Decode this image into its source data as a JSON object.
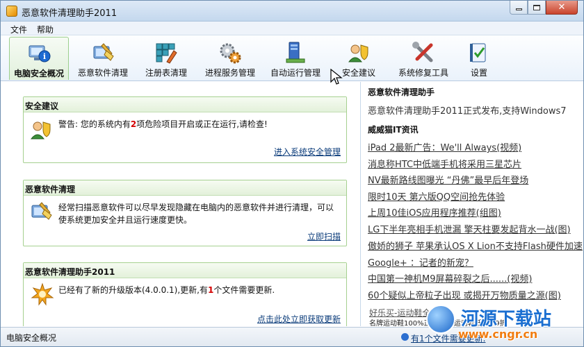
{
  "window": {
    "title": "恶意软件清理助手2011"
  },
  "menu": [
    "文件",
    "帮助"
  ],
  "toolbar": {
    "items": [
      {
        "label": "电脑安全概况",
        "icon": "pc-info-icon",
        "active": true
      },
      {
        "label": "恶意软件清理",
        "icon": "malware-clean-icon",
        "active": false
      },
      {
        "label": "注册表清理",
        "icon": "registry-clean-icon",
        "active": false
      },
      {
        "label": "进程服务管理",
        "icon": "gears-icon",
        "active": false
      },
      {
        "label": "自动运行管理",
        "icon": "autorun-icon",
        "active": false
      },
      {
        "label": "安全建议",
        "icon": "security-user-icon",
        "active": false
      },
      {
        "label": "系统修复工具",
        "icon": "repair-tools-icon",
        "active": false
      },
      {
        "label": "设置",
        "icon": "settings-icon",
        "active": false
      }
    ]
  },
  "cards": {
    "security": {
      "title": "安全建议",
      "text_before": "警告: 您的系统内有",
      "count": "2",
      "text_after": "项危险项目开启或正在运行,请检查!",
      "link": "进入系统安全管理"
    },
    "malware": {
      "title": "恶意软件清理",
      "text": "经常扫描恶意软件可以尽早发现隐藏在电脑内的恶意软件并进行清理，可以使系统更加安全并且运行速度更快。",
      "link": "立即扫描"
    },
    "update": {
      "title": "恶意软件清理助手2011",
      "text_before": "已经有了新的升级版本(4.0.0.1),更新,有",
      "count": "1",
      "text_after": "个文件需要更新.",
      "link": "点击此处立即获取更新"
    }
  },
  "right": {
    "heading1": "恶意软件清理助手",
    "announcement": "恶意软件清理助手2011正式发布,支持Windows7",
    "heading2": "威威猫IT资讯",
    "news": [
      "iPad 2最新广告：We'll Always(视频)",
      "消息称HTC中低端手机将采用三星芯片",
      "NV最新路线图曝光 “丹佛”最早后年登场",
      "限时10天 第六版QQ空间抢先体验",
      "上周10佳iOS应用程序推荐(组图)",
      "LG下半年亮相手机泄漏 擎天柱要发起背水一战(图)",
      "傲娇的狮子 苹果承认OS X Lion不支持Flash硬件加速",
      "Google+ ：记者的新宠？",
      "中国第一神机M9屏幕碎裂之后......(视频)",
      "60个疑似上帝粒子出现 或揭开万物质量之源(图)"
    ],
    "ad_line1": "好乐买-运动鞋全场",
    "ad_line2": "名牌运动鞋100%正品,全场运动鞋低至1.9折"
  },
  "status": {
    "text": "电脑安全概况",
    "update_link": "有1个文件需要更新."
  },
  "watermark": {
    "name": "河源下载站",
    "url": "www.cngr.cn"
  },
  "colors": {
    "accent_green": "#a5d08f",
    "warning_red": "#d40000",
    "link_blue": "#0a3b7a"
  }
}
